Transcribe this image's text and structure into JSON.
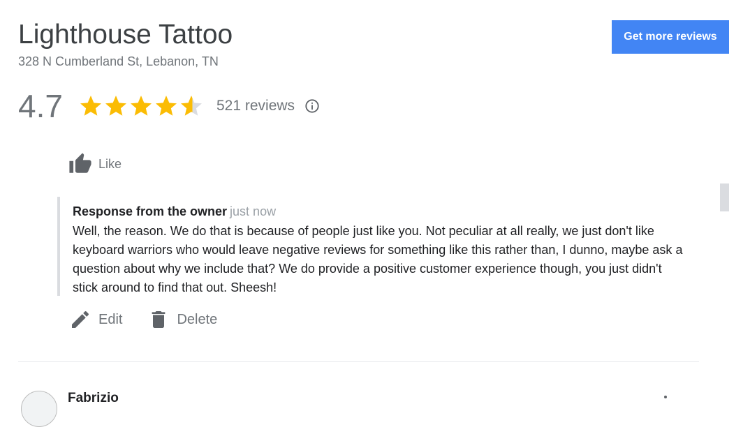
{
  "business": {
    "name": "Lighthouse Tattoo",
    "address": "328 N Cumberland St, Lebanon, TN"
  },
  "header": {
    "cta_label": "Get more reviews",
    "accent_color": "#4285f4"
  },
  "rating": {
    "value": "4.7",
    "stars_out_of_5": 4.7,
    "reviews_label": "521 reviews",
    "star_color": "#fbbc04"
  },
  "review_actions": {
    "like_label": "Like"
  },
  "owner_response": {
    "author": "Response from the owner",
    "time": "just now",
    "text": "Well, the reason. We do that is because of people just like you. Not peculiar at all really, we just don't like keyboard warriors who would leave negative reviews for something like this rather than, I dunno, maybe ask a question about why we include that? We do provide a positive customer experience though, you just didn't stick around to find that out. Sheesh!",
    "edit_label": "Edit",
    "delete_label": "Delete"
  },
  "next_review": {
    "author": "Fabrizio"
  }
}
